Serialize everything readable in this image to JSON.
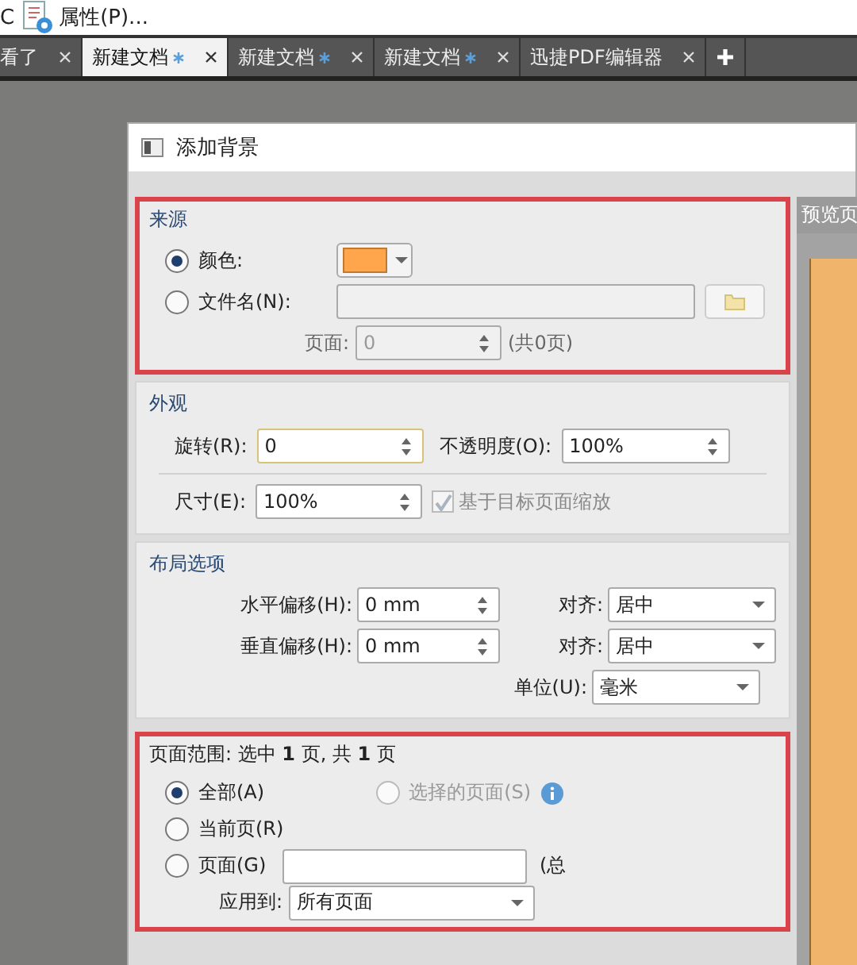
{
  "toolbar": {
    "partial_text": "C",
    "item": "属性(P)..."
  },
  "tabs": [
    {
      "label": "看了",
      "modified": false,
      "selected": false
    },
    {
      "label": "新建文档",
      "modified": true,
      "selected": true
    },
    {
      "label": "新建文档",
      "modified": true,
      "selected": false
    },
    {
      "label": "新建文档",
      "modified": true,
      "selected": false
    },
    {
      "label": "迅捷PDF编辑器",
      "modified": false,
      "selected": false
    }
  ],
  "dialog": {
    "title": "添加背景",
    "preview_label": "预览页",
    "source": {
      "title": "来源",
      "highlighted": true,
      "options": [
        {
          "kind": "color",
          "label": "颜色:",
          "selected": true,
          "color": "#ffa64d"
        },
        {
          "kind": "file",
          "label": "文件名(N):",
          "selected": false
        }
      ],
      "page_label": "页面:",
      "page_value": "0",
      "page_total": "(共0页)"
    },
    "appearance": {
      "title": "外观",
      "rotation_label": "旋转(R):",
      "rotation_value": "0",
      "opacity_label": "不透明度(O):",
      "opacity_value": "100%",
      "size_label": "尺寸(E):",
      "size_value": "100%",
      "scale_checkbox": {
        "label": "基于目标页面缩放",
        "checked": true,
        "disabled": true
      }
    },
    "layout": {
      "title": "布局选项",
      "rows": [
        {
          "label": "水平偏移(H):",
          "value": "0 mm",
          "align_label": "对齐:",
          "align_value": "居中"
        },
        {
          "label": "垂直偏移(H):",
          "value": "0 mm",
          "align_label": "对齐:",
          "align_value": "居中"
        }
      ],
      "unit_label": "单位(U):",
      "unit_value": "毫米"
    },
    "page_range": {
      "title": "页面范围: 选中 **1** 页, 共 **1** 页",
      "highlighted": true,
      "options": [
        {
          "label": "全部(A)",
          "selected": true,
          "disabled": false
        },
        {
          "label": "选择的页面(S)",
          "selected": false,
          "disabled": true
        },
        {
          "label": "当前页(R)",
          "selected": false,
          "disabled": false
        },
        {
          "label": "页面(G)",
          "selected": false,
          "disabled": false
        }
      ],
      "total_text": "(总",
      "apply_label": "应用到:",
      "apply_value": "所有页面"
    }
  }
}
